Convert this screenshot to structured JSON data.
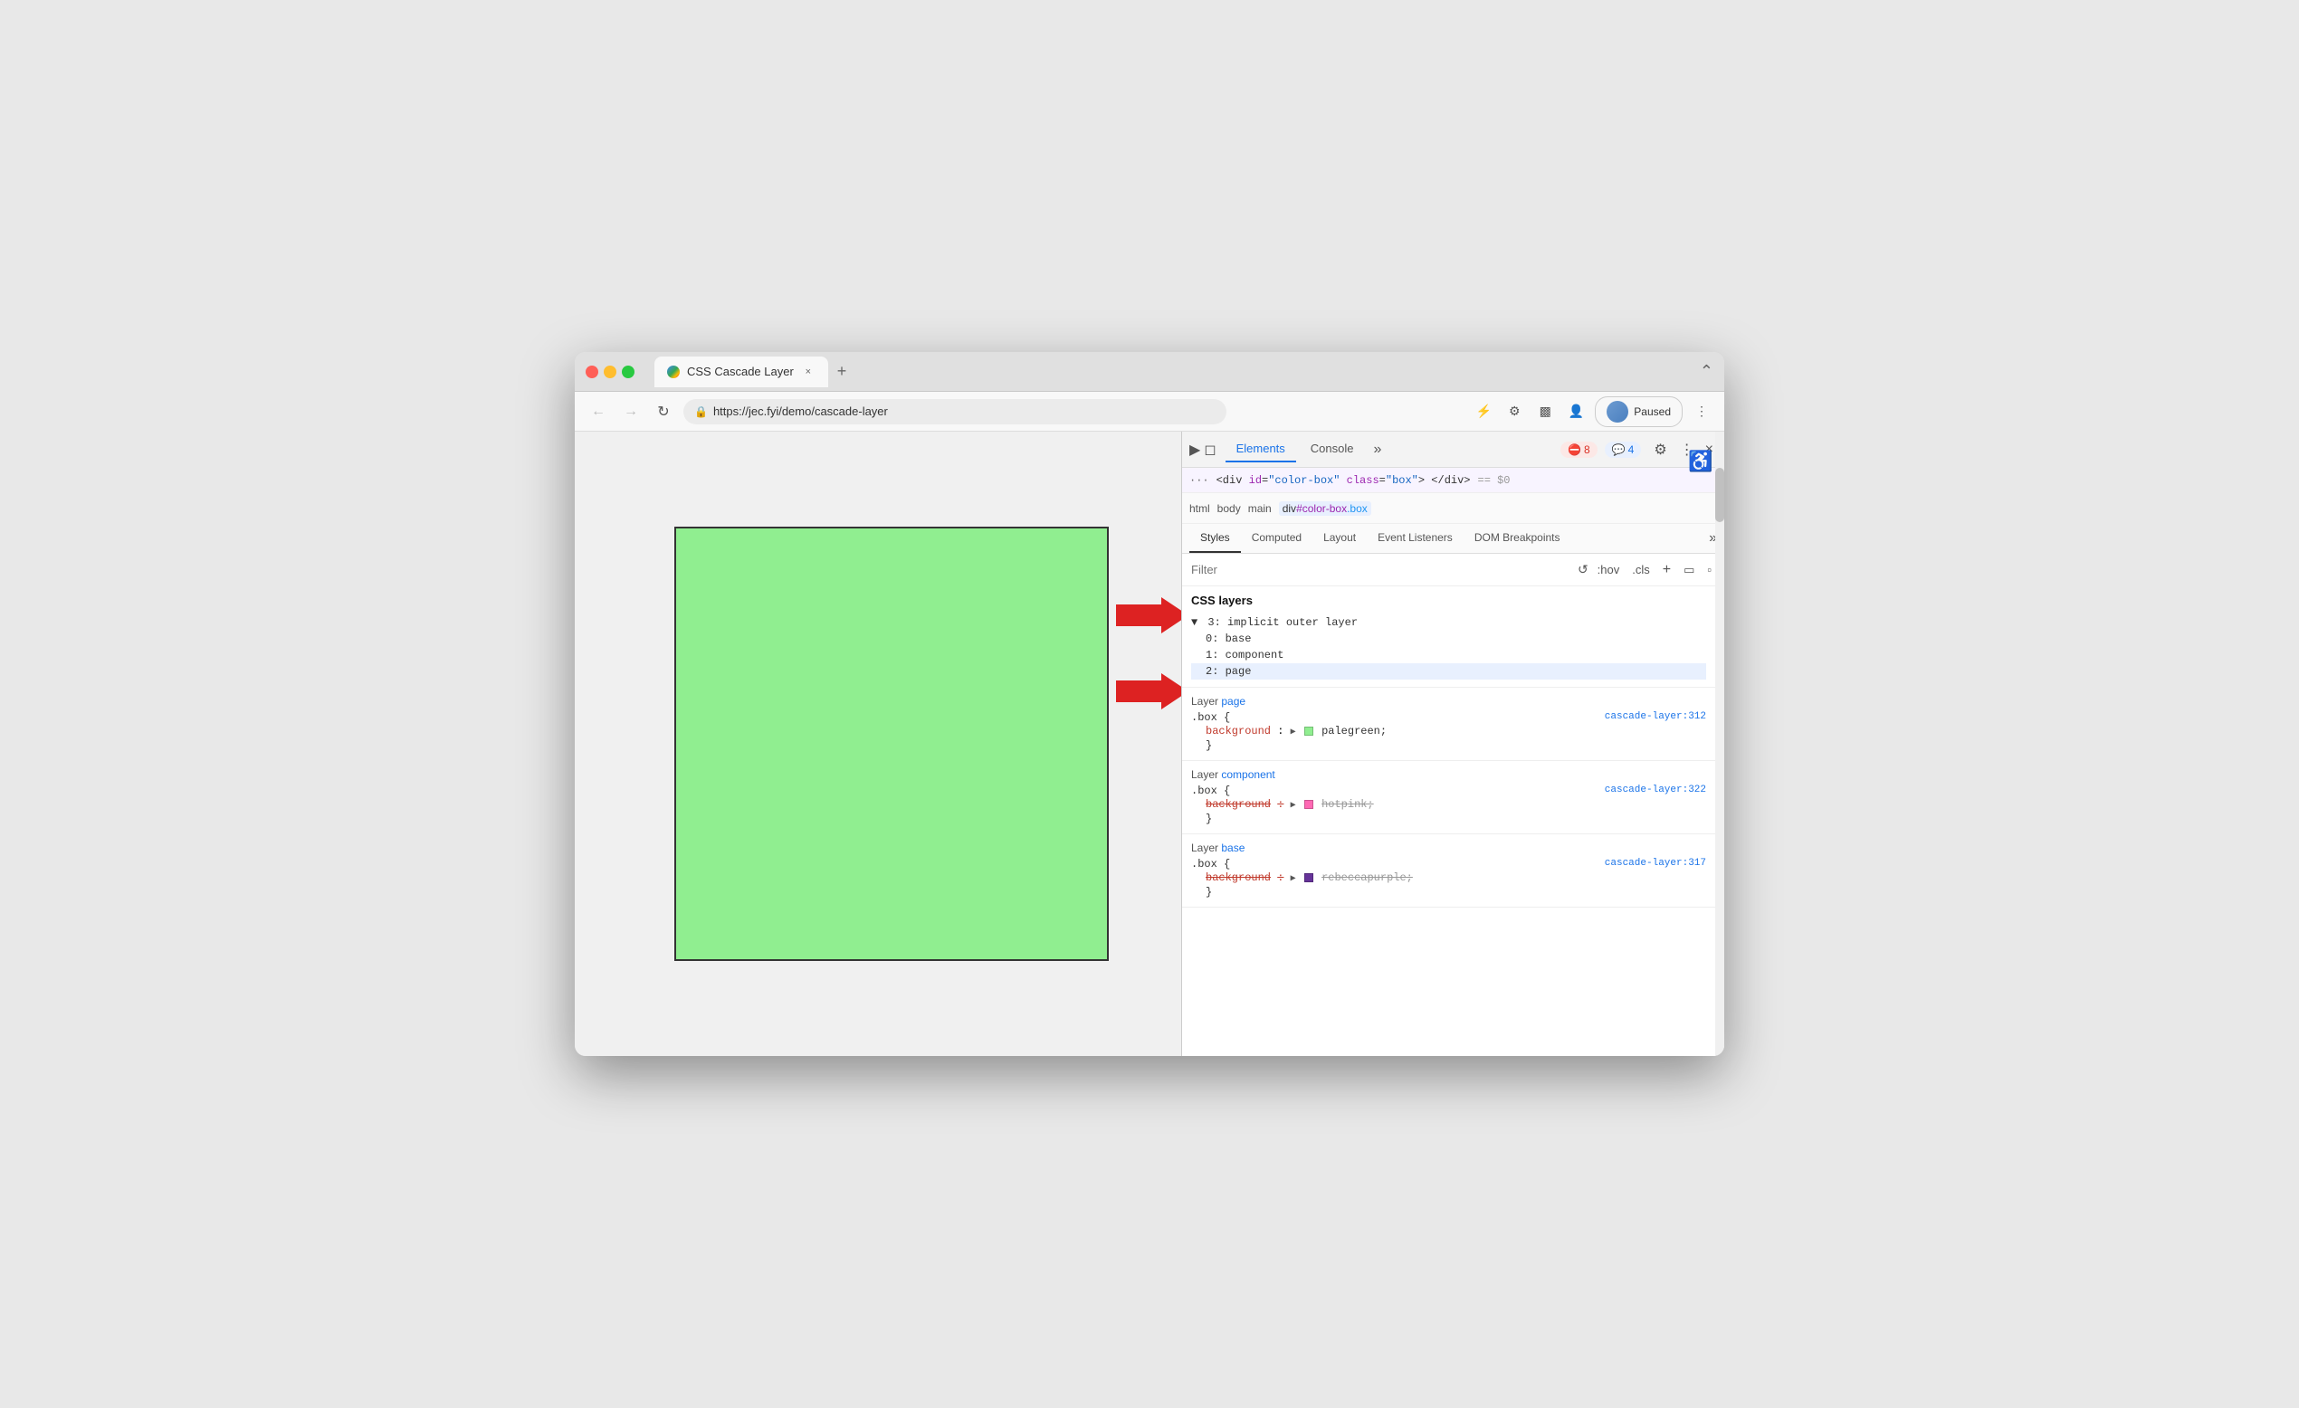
{
  "browser": {
    "title": "CSS Cascade Layer",
    "url": "https://jec.fyi/demo/cascade-layer",
    "tab_close": "×",
    "tab_new": "+",
    "tab_menu": "⌃",
    "paused_label": "Paused"
  },
  "devtools": {
    "tabs": [
      "Elements",
      "Console"
    ],
    "tab_more": "»",
    "active_tab": "Elements",
    "error_badge": "8",
    "warning_badge": "4",
    "close": "×",
    "dom_node": {
      "dots": "···",
      "tag_open": "<div",
      "attr_id_name": "id",
      "attr_id_value": "\"color-box\"",
      "attr_class_name": "class",
      "attr_class_value": "\"box\"",
      "tag_close": "> </div>",
      "comment": "== $0"
    },
    "breadcrumb": {
      "html": "html",
      "body": "body",
      "main": "main",
      "selected": "div#color-box.box"
    },
    "subtabs": [
      "Styles",
      "Computed",
      "Layout",
      "Event Listeners",
      "DOM Breakpoints"
    ],
    "active_subtab": "Styles",
    "filter_placeholder": "Filter",
    "filter_actions": [
      ":hov",
      ".cls",
      "+",
      "⬚",
      "⬚"
    ],
    "css_layers": {
      "title": "CSS layers",
      "tree": {
        "parent": "3: implicit outer layer",
        "children": [
          "0: base",
          "1: component",
          "2: page"
        ]
      },
      "highlighted_child": "2: page"
    },
    "rules": [
      {
        "layer_label": "Layer",
        "layer_name": "page",
        "selector": ".box {",
        "source": "cascade-layer:312",
        "properties": [
          {
            "name": "background",
            "separator": ": ",
            "color": "#90ee90",
            "color_name": "palegreen",
            "strikethrough": false,
            "has_arrow": true
          }
        ],
        "close": "}"
      },
      {
        "layer_label": "Layer",
        "layer_name": "component",
        "selector": ".box {",
        "source": "cascade-layer:322",
        "properties": [
          {
            "name": "background",
            "separator": ":",
            "color": "#ff69b4",
            "color_name": "hotpink",
            "strikethrough": true,
            "has_arrow": true
          }
        ],
        "close": "}"
      },
      {
        "layer_label": "Layer",
        "layer_name": "base",
        "selector": ".box {",
        "source": "cascade-layer:317",
        "properties": [
          {
            "name": "background",
            "separator": ":",
            "color": "#663399",
            "color_name": "rebeccapurple",
            "strikethrough": true,
            "has_arrow": true
          }
        ],
        "close": "}"
      }
    ],
    "arrows": [
      {
        "label": "CSS layers arrow",
        "top_pct": 43
      },
      {
        "label": "Layer page arrow",
        "top_pct": 62
      }
    ]
  }
}
